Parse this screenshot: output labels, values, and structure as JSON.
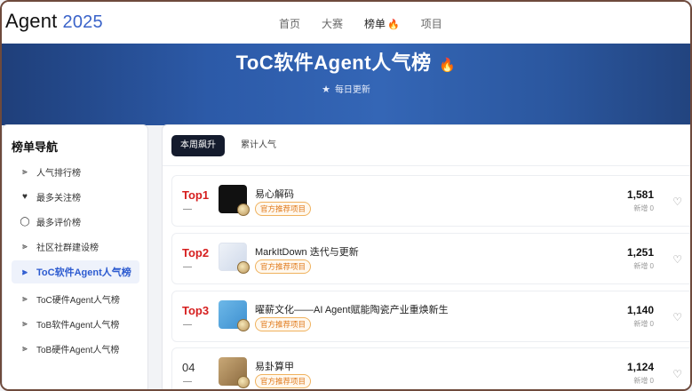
{
  "header": {
    "logo": "Agent",
    "year": "2025",
    "nav": [
      {
        "label": "首页"
      },
      {
        "label": "大赛"
      },
      {
        "label": "榜单"
      },
      {
        "label": "项目"
      }
    ]
  },
  "banner": {
    "title": "ToC软件Agent人气榜",
    "subtitle": "每日更新"
  },
  "sidebar": {
    "title": "榜单导航",
    "items": [
      {
        "label": "人气排行榜",
        "icon": "bar-chart-icon"
      },
      {
        "label": "最多关注榜",
        "icon": "heart-icon"
      },
      {
        "label": "最多评价榜",
        "icon": "comment-icon"
      },
      {
        "label": "社区社群建设榜",
        "icon": "bar-chart-icon"
      },
      {
        "label": "ToC软件Agent人气榜",
        "icon": "bar-chart-icon"
      },
      {
        "label": "ToC硬件Agent人气榜",
        "icon": "bar-chart-icon"
      },
      {
        "label": "ToB软件Agent人气榜",
        "icon": "bar-chart-icon"
      },
      {
        "label": "ToB硬件Agent人气榜",
        "icon": "bar-chart-icon"
      }
    ]
  },
  "tabs": [
    {
      "label": "本周飙升"
    },
    {
      "label": "累计人气"
    }
  ],
  "rankings": [
    {
      "rank": "Top1",
      "trend": "—",
      "name": "易心解码",
      "badge": "官方推荐项目",
      "score": "1,581",
      "inc": "新增 0"
    },
    {
      "rank": "Top2",
      "trend": "—",
      "name": "MarkItDown 迭代与更新",
      "badge": "官方推荐项目",
      "score": "1,251",
      "inc": "新增 0"
    },
    {
      "rank": "Top3",
      "trend": "—",
      "name": "曜薪文化——AI Agent赋能陶瓷产业重焕新生",
      "badge": "官方推荐项目",
      "score": "1,140",
      "inc": "新增 0"
    },
    {
      "rank": "04",
      "trend": "—",
      "name": "易卦算甲",
      "badge": "官方推荐项目",
      "score": "1,124",
      "inc": "新增 0"
    }
  ],
  "colors": {
    "accent": "#2d5bd0",
    "top_rank": "#d61f1f",
    "badge": "#e07a1c"
  }
}
